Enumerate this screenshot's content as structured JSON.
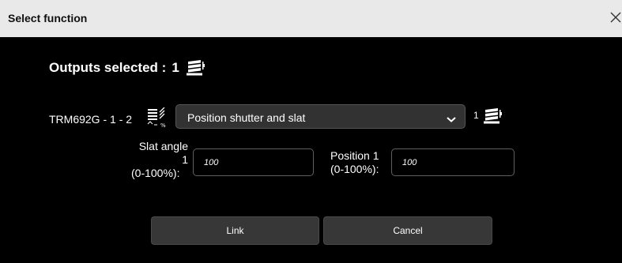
{
  "dialog": {
    "title": "Select function",
    "close_icon": "close-icon"
  },
  "outputs": {
    "label": "Outputs selected :",
    "count": "1",
    "icon": "shutter-stack-icon"
  },
  "device": {
    "label": "TRM692G - 1 - 2",
    "icon": "shutter-slat-percent-icon",
    "function_select": {
      "value": "Position shutter and slat",
      "chevron_icon": "chevron-down-icon"
    },
    "output_count": "1",
    "output_icon": "shutter-stack-icon"
  },
  "fields": {
    "slat_angle": {
      "label_line1": "Slat angle",
      "label_line2": "1",
      "label_line3": "(0-100%):",
      "value": "100"
    },
    "position": {
      "label_line1": "Position 1",
      "label_line2": "(0-100%):",
      "value": "100"
    }
  },
  "buttons": {
    "link": "Link",
    "cancel": "Cancel"
  },
  "colors": {
    "background": "#000000",
    "titlebar": "#e9e9e9",
    "button": "#373737",
    "select": "#323232",
    "text": "#ffffff"
  }
}
